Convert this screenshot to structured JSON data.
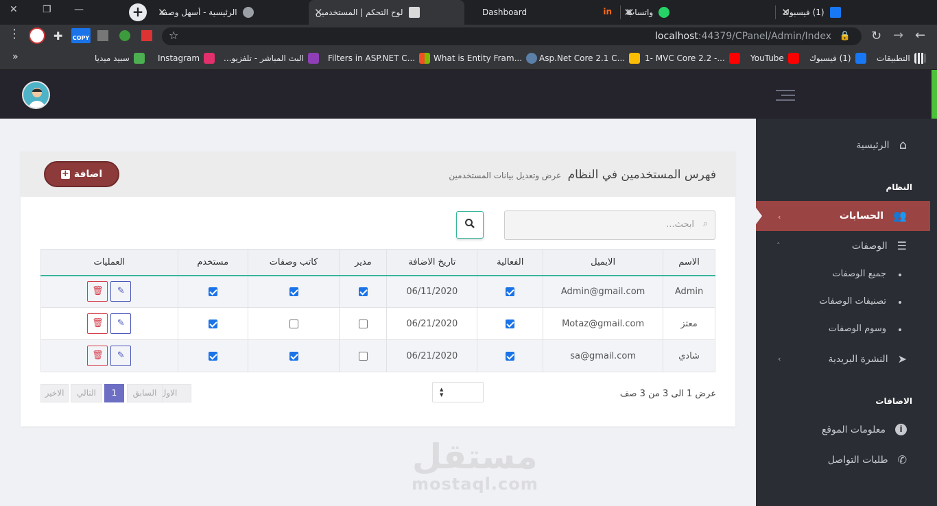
{
  "browser": {
    "tabs": [
      {
        "title": "(1) فيسبوك",
        "favicon_color": "#1877f2"
      },
      {
        "title": "واتساب",
        "favicon_color": "#25d366"
      },
      {
        "title": "Dashboard",
        "favicon_color": "#ff6b1a"
      },
      {
        "title": "لوح التحكم | المستخدمين",
        "favicon_color": "#d9d9d9"
      },
      {
        "title": "الرئيسية - أسهل وصفة",
        "favicon_color": "#9aa0a6"
      }
    ],
    "active_tab_index": 3,
    "url_host": "localhost",
    "url_path": ":44379/CPanel/Admin/Index",
    "copy_ext_label": "COPY",
    "bookmarks": [
      {
        "label": "التطبيقات"
      },
      {
        "label": "(1) فيسبوك"
      },
      {
        "label": "YouTube"
      },
      {
        "label": "1- MVC Core 2.2 -..."
      },
      {
        "label": "Asp.Net Core 2.1 C..."
      },
      {
        "label": "What is Entity Fram..."
      },
      {
        "label": "Filters in ASP.NET C..."
      },
      {
        "label": "البث المباشر - تلفزيو..."
      },
      {
        "label": "Instagram"
      },
      {
        "label": "سبيد ميديا"
      }
    ],
    "bookmarks_overflow": "»"
  },
  "sidebar": {
    "home": "الرئيسية",
    "section_system": "النظام",
    "accounts": "الحسابات",
    "recipes": "الوصفات",
    "recipes_sub": [
      "جميع الوصفات",
      "تصنيفات الوصفات",
      "وسوم الوصفات"
    ],
    "newsletter": "النشرة البريدية",
    "section_additions": "الاضافات",
    "site_info": "معلومات الموقع",
    "contact_requests": "طلبات التواصل"
  },
  "main": {
    "title": "فهرس المستخدمين في النظام",
    "subtitle": "عرض وتعديل بيانات المستخدمين",
    "add_button": "اضافة",
    "search_placeholder": "ابحث...",
    "table": {
      "columns": [
        "الاسم",
        "الايميل",
        "الفعالية",
        "تاريخ الاضافة",
        "مدير",
        "كاتب وصفات",
        "مستخدم",
        "العمليات"
      ],
      "rows": [
        {
          "name": "Admin",
          "email": "Admin@gmail.com",
          "active": true,
          "date": "06/11/2020",
          "admin": true,
          "writer": true,
          "user": true
        },
        {
          "name": "معتز",
          "email": "Motaz@gmail.com",
          "active": true,
          "date": "06/21/2020",
          "admin": false,
          "writer": false,
          "user": true
        },
        {
          "name": "شادي",
          "email": "sa@gmail.com",
          "active": true,
          "date": "06/21/2020",
          "admin": false,
          "writer": true,
          "user": true
        }
      ]
    },
    "info": "عرض 1 الى 3 من 3 صف",
    "pagination": {
      "first": "الاول",
      "prev": "السابق",
      "current": "1",
      "next": "التالي",
      "last": "الاخير"
    }
  },
  "watermark": {
    "arabic": "مستقل",
    "latin": "mostaql.com"
  },
  "colors": {
    "accent": "#9b4444",
    "add_button": "#8c3a3a",
    "table_header_rule": "#36b59a",
    "page_current": "#6d6fc4",
    "checkbox": "#1a73e8"
  }
}
